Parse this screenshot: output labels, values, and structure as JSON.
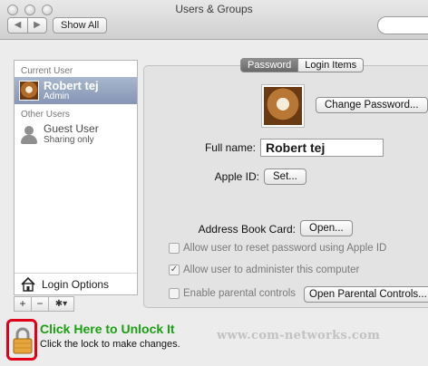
{
  "window": {
    "title": "Users & Groups",
    "back_glyph": "◀",
    "forward_glyph": "▶",
    "show_all": "Show All"
  },
  "sidebar": {
    "current_user_heading": "Current User",
    "current_user": {
      "name": "Robert tej",
      "role": "Admin"
    },
    "other_users_heading": "Other Users",
    "other_users": [
      {
        "name": "Guest User",
        "role": "Sharing only"
      }
    ],
    "login_options": "Login Options",
    "add_glyph": "+",
    "remove_glyph": "−",
    "action_glyph": "✱▾"
  },
  "tabs": [
    {
      "label": "Password"
    },
    {
      "label": "Login Items"
    }
  ],
  "account": {
    "change_password": "Change Password...",
    "full_name_label": "Full name:",
    "full_name_value": "Robert tej",
    "apple_id_label": "Apple ID:",
    "set_button": "Set...",
    "address_book_label": "Address Book Card:",
    "open_button": "Open...",
    "allow_reset": {
      "label": "Allow user to reset password using Apple ID",
      "checked": false,
      "enabled": false
    },
    "allow_admin": {
      "label": "Allow user to administer this computer",
      "checked": true,
      "enabled": false,
      "mark": "✓"
    },
    "parental": {
      "label": "Enable parental controls",
      "checked": false,
      "enabled": false
    },
    "open_parental": "Open Parental Controls..."
  },
  "bottom": {
    "unlock_hint": "Click Here to Unlock It",
    "lock_message": "Click the lock to make changes.",
    "watermark": "www.com-networks.com"
  },
  "colors": {
    "selection": "#8595b4",
    "hint_green": "#1aa012",
    "lock_frame_red": "#e0001a"
  }
}
